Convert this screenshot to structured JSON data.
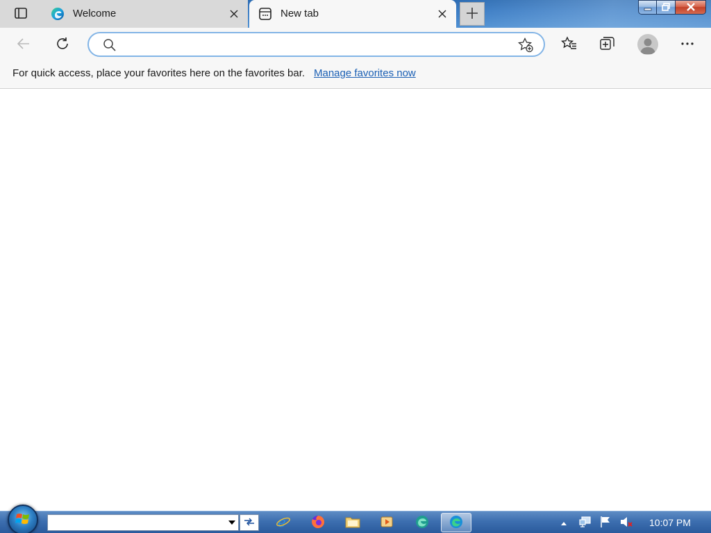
{
  "browser": {
    "tabs": [
      {
        "title": "Welcome",
        "active": false
      },
      {
        "title": "New tab",
        "active": true
      }
    ],
    "address_bar": {
      "value": "",
      "placeholder": ""
    },
    "favorites_bar": {
      "message": "For quick access, place your favorites here on the favorites bar.",
      "link_label": "Manage favorites now"
    }
  },
  "taskbar": {
    "search": {
      "value": ""
    },
    "apps": [
      "internet-explorer",
      "firefox",
      "file-explorer",
      "media-player",
      "edge-beta",
      "edge"
    ],
    "active_app": "edge",
    "clock": "10:07 PM"
  },
  "colors": {
    "accent_focus": "#82b4e6",
    "link": "#1a5fb4",
    "taskbar": "#3d6fb0",
    "close_button": "#c2412a"
  }
}
